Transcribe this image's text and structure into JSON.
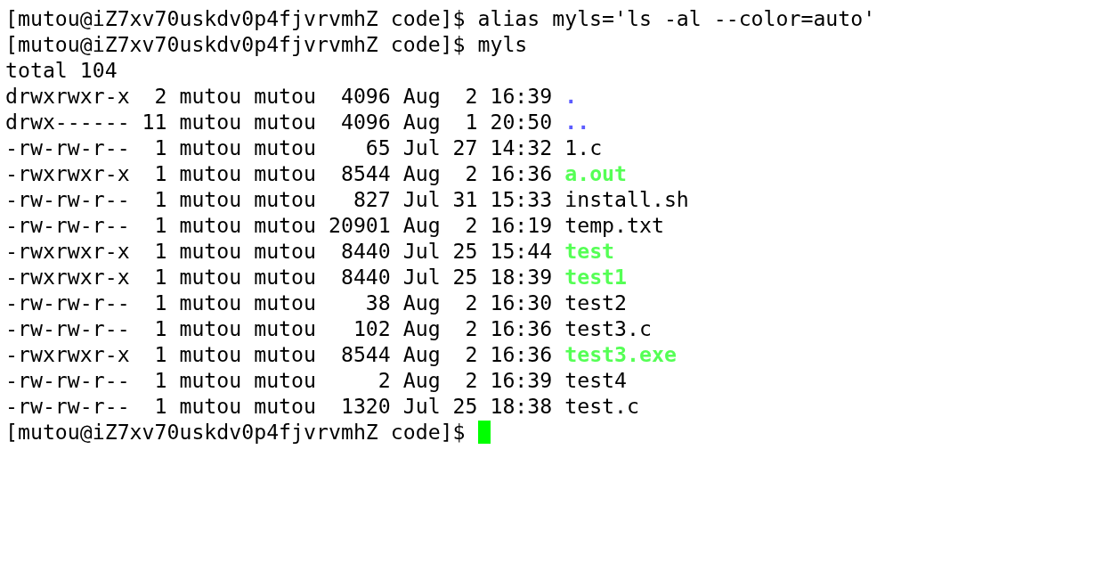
{
  "lines": [
    {
      "kind": "command",
      "text": "[mutou@iZ7xv70uskdv0p4fjvrvmhZ code]$ alias myls='ls -al --color=auto'"
    },
    {
      "kind": "command",
      "text": "[mutou@iZ7xv70uskdv0p4fjvrvmhZ code]$ myls"
    },
    {
      "kind": "output",
      "text": "total 104"
    },
    {
      "kind": "directory",
      "info": "drwxrwxr-x  2 mutou mutou  4096 Aug  2 16:39",
      "name": "."
    },
    {
      "kind": "directory",
      "info": "drwx------ 11 mutou mutou  4096 Aug  1 20:50",
      "name": ".."
    },
    {
      "kind": "file",
      "info": "-rw-rw-r--  1 mutou mutou    65 Jul 27 14:32",
      "name": "1.c"
    },
    {
      "kind": "executable",
      "info": "-rwxrwxr-x  1 mutou mutou  8544 Aug  2 16:36",
      "name": "a.out"
    },
    {
      "kind": "file",
      "info": "-rw-rw-r--  1 mutou mutou   827 Jul 31 15:33",
      "name": "install.sh"
    },
    {
      "kind": "file",
      "info": "-rw-rw-r--  1 mutou mutou 20901 Aug  2 16:19",
      "name": "temp.txt"
    },
    {
      "kind": "executable",
      "info": "-rwxrwxr-x  1 mutou mutou  8440 Jul 25 15:44",
      "name": "test"
    },
    {
      "kind": "executable",
      "info": "-rwxrwxr-x  1 mutou mutou  8440 Jul 25 18:39",
      "name": "test1"
    },
    {
      "kind": "file",
      "info": "-rw-rw-r--  1 mutou mutou    38 Aug  2 16:30",
      "name": "test2"
    },
    {
      "kind": "file",
      "info": "-rw-rw-r--  1 mutou mutou   102 Aug  2 16:36",
      "name": "test3.c"
    },
    {
      "kind": "executable",
      "info": "-rwxrwxr-x  1 mutou mutou  8544 Aug  2 16:36",
      "name": "test3.exe"
    },
    {
      "kind": "file",
      "info": "-rw-rw-r--  1 mutou mutou     2 Aug  2 16:39",
      "name": "test4"
    },
    {
      "kind": "file",
      "info": "-rw-rw-r--  1 mutou mutou  1320 Jul 25 18:38",
      "name": "test.c"
    },
    {
      "kind": "prompt",
      "text": "[mutou@iZ7xv70uskdv0p4fjvrvmhZ code]$"
    }
  ]
}
